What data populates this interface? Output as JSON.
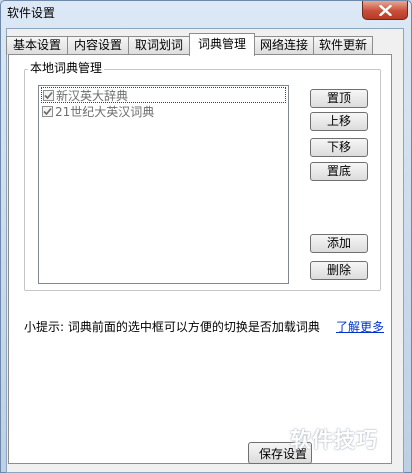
{
  "window": {
    "title": "软件设置"
  },
  "tabs": [
    {
      "label": "基本设置",
      "active": false
    },
    {
      "label": "内容设置",
      "active": false
    },
    {
      "label": "取词划词",
      "active": false
    },
    {
      "label": "词典管理",
      "active": true
    },
    {
      "label": "网络连接",
      "active": false
    },
    {
      "label": "软件更新",
      "active": false
    }
  ],
  "dict_group": {
    "title": "本地词典管理",
    "items": [
      {
        "label": "新汉英大辞典",
        "checked": true,
        "focused": true
      },
      {
        "label": "21世纪大英汉词典",
        "checked": true,
        "focused": false
      }
    ],
    "buttons": {
      "top": "置顶",
      "up": "上移",
      "down": "下移",
      "bottom": "置底",
      "add": "添加",
      "delete": "删除"
    }
  },
  "hint": {
    "text": "小提示: 词典前面的选中框可以方便的切换是否加载词典",
    "link": "了解更多"
  },
  "footer": {
    "save_label": "保存设置"
  },
  "watermark": "软件技巧"
}
